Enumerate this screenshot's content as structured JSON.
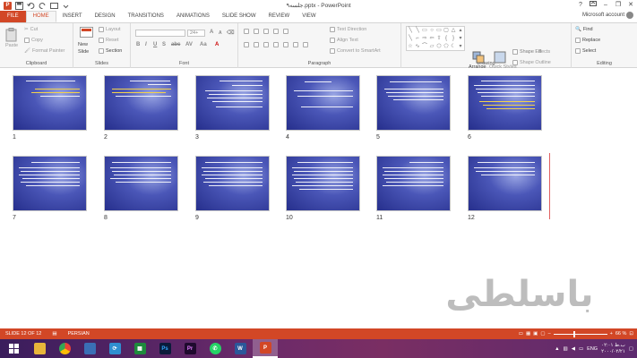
{
  "titlebar": {
    "title": "جلسه۹.pptx - PowerPoint",
    "help": "?",
    "minimize": "–",
    "restore": "❐",
    "close": "✕"
  },
  "tabs": [
    {
      "label": "FILE"
    },
    {
      "label": "HOME"
    },
    {
      "label": "INSERT"
    },
    {
      "label": "DESIGN"
    },
    {
      "label": "TRANSITIONS"
    },
    {
      "label": "ANIMATIONS"
    },
    {
      "label": "SLIDE SHOW"
    },
    {
      "label": "REVIEW"
    },
    {
      "label": "VIEW"
    }
  ],
  "account": {
    "label": "Microsoft account"
  },
  "ribbon": {
    "clipboard": {
      "label": "Clipboard",
      "paste": "Paste",
      "cut": "Cut",
      "copy": "Copy",
      "format_painter": "Format Painter"
    },
    "slides": {
      "label": "Slides",
      "new_slide": "New",
      "new_slide_2": "Slide",
      "layout": "Layout",
      "reset": "Reset",
      "section": "Section"
    },
    "font": {
      "label": "Font",
      "size": "24+"
    },
    "paragraph": {
      "label": "Paragraph",
      "text_direction": "Text Direction",
      "align_text": "Align Text",
      "smartart": "Convert to SmartArt"
    },
    "drawing": {
      "label": "Drawing",
      "arrange": "Arrange",
      "quick_styles": "Quick Styles",
      "shape_fill": "Shape Fill",
      "shape_outline": "Shape Outline",
      "shape_effects": "Shape Effects"
    },
    "editing": {
      "label": "Editing",
      "find": "Find",
      "replace": "Replace",
      "select": "Select"
    }
  },
  "slides": [
    {
      "number": "1"
    },
    {
      "number": "2"
    },
    {
      "number": "3"
    },
    {
      "number": "4"
    },
    {
      "number": "5"
    },
    {
      "number": "6"
    },
    {
      "number": "7"
    },
    {
      "number": "8"
    },
    {
      "number": "9"
    },
    {
      "number": "10"
    },
    {
      "number": "11"
    },
    {
      "number": "12"
    }
  ],
  "watermark": "باسلطی",
  "statusbar": {
    "slide_counter": "SLIDE 12 OF 12",
    "language": "PERSIAN",
    "zoom": "66 %"
  },
  "tray": {
    "lang": "ENG",
    "time": "۰۲:۰۱ ب.ظ",
    "date": "۲۰۰۰/۰۲/۲۱"
  },
  "colors": {
    "accent": "#d24726",
    "slide_bg": "#2e3a9c",
    "taskbar": "#5c2a6e"
  }
}
